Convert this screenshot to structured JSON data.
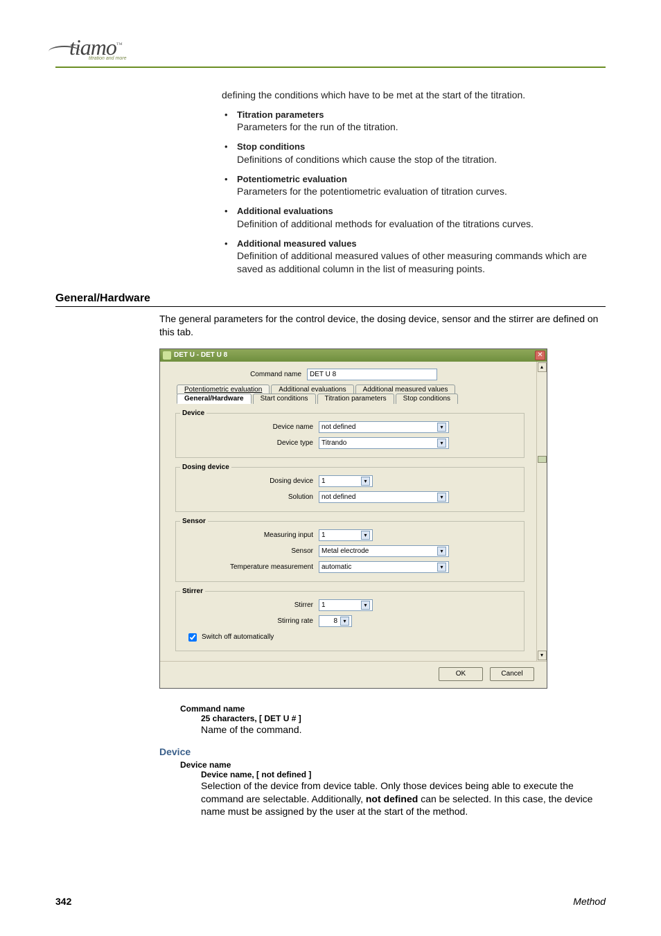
{
  "logo": {
    "text": "tiamo",
    "tm": "™",
    "sub": "titration and more"
  },
  "intro": "defining the conditions which have to be met at the start of the titration.",
  "bullets": [
    {
      "title": "Titration parameters",
      "desc": "Parameters for the run of the titration."
    },
    {
      "title": "Stop conditions",
      "desc": "Definitions of conditions which cause the stop of the titration."
    },
    {
      "title": "Potentiometric evaluation",
      "desc": "Parameters for the potentiometric evaluation of titration curves."
    },
    {
      "title": "Additional evaluations",
      "desc": "Definition of additional methods for evaluation of the titrations curves."
    },
    {
      "title": "Additional measured values",
      "desc": "Definition of additional measured values of other measuring commands which are saved as additional column in the list of measuring points."
    }
  ],
  "section_title": "General/Hardware",
  "section_intro": "The general parameters for the control device, the dosing device, sensor and the stirrer are defined on this tab.",
  "dialog": {
    "title": "DET U - DET U 8",
    "command_name_label": "Command name",
    "command_name_value": "DET U 8",
    "tabs_row1": [
      "Potentiometric evaluation",
      "Additional evaluations",
      "Additional measured values"
    ],
    "tabs_row2": [
      "General/Hardware",
      "Start conditions",
      "Titration parameters",
      "Stop conditions"
    ],
    "active_tab": "General/Hardware",
    "device": {
      "legend": "Device",
      "name_label": "Device name",
      "name_value": "not defined",
      "type_label": "Device type",
      "type_value": "Titrando"
    },
    "dosing": {
      "legend": "Dosing device",
      "device_label": "Dosing device",
      "device_value": "1",
      "solution_label": "Solution",
      "solution_value": "not defined"
    },
    "sensor": {
      "legend": "Sensor",
      "input_label": "Measuring input",
      "input_value": "1",
      "sensor_label": "Sensor",
      "sensor_value": "Metal electrode",
      "temp_label": "Temperature measurement",
      "temp_value": "automatic"
    },
    "stirrer": {
      "legend": "Stirrer",
      "stirrer_label": "Stirrer",
      "stirrer_value": "1",
      "rate_label": "Stirring rate",
      "rate_value": "8",
      "switch_off_label": "Switch off automatically"
    },
    "ok": "OK",
    "cancel": "Cancel"
  },
  "def_command": {
    "term": "Command name",
    "sub": "25 characters, [ DET U # ]",
    "body": "Name of the command."
  },
  "sub_heading": "Device",
  "def_device": {
    "term": "Device name",
    "sub": "Device name, [ not defined ]",
    "body_parts": [
      "Selection of the device from device table. Only those devices being able to execute the command are selectable. Additionally, ",
      "not defined",
      " can be selected. In this case, the device name must be assigned by the user at the start of the method."
    ]
  },
  "footer": {
    "page": "342",
    "section": "Method"
  }
}
